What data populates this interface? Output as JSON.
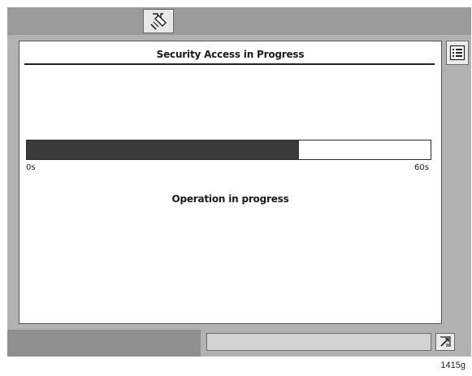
{
  "panel": {
    "title": "Security Access in Progress",
    "status": "Operation in progress"
  },
  "progress": {
    "value": 0.675,
    "min_label": "0s",
    "max_label": "60s"
  },
  "icons": {
    "top": "diagnostic-tool-icon",
    "right": "list-menu-icon",
    "bottom": "exit-icon"
  },
  "figure_code": "1415g",
  "colors": {
    "frame": "#b2b2b2",
    "top_bar": "#9b9b9b",
    "bottom_bar": "#8f8f8f",
    "progress_fill": "#3a3a3a",
    "panel": "#ffffff"
  }
}
